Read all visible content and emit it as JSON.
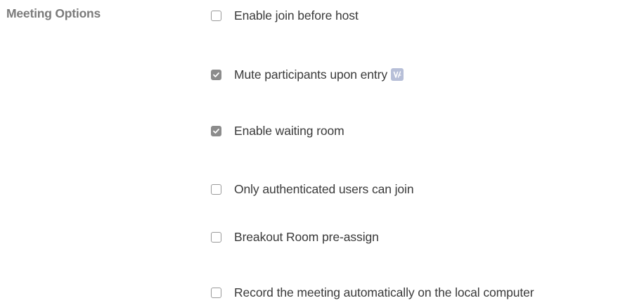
{
  "section": {
    "label": "Meeting Options"
  },
  "options": [
    {
      "label": "Enable join before host",
      "checked": false
    },
    {
      "label": "Mute participants upon entry",
      "checked": true,
      "badge_icon": "video-info-icon"
    },
    {
      "label": "Enable waiting room",
      "checked": true
    },
    {
      "label": "Only authenticated users can join",
      "checked": false
    },
    {
      "label": "Breakout Room pre-assign",
      "checked": false
    },
    {
      "label": "Record the meeting automatically on the local computer",
      "checked": false
    }
  ],
  "colors": {
    "label_gray": "#7b7b7b",
    "text": "#3a3a3a",
    "checkbox_checked": "#8c8c8c",
    "badge": "#b7bfd8"
  }
}
